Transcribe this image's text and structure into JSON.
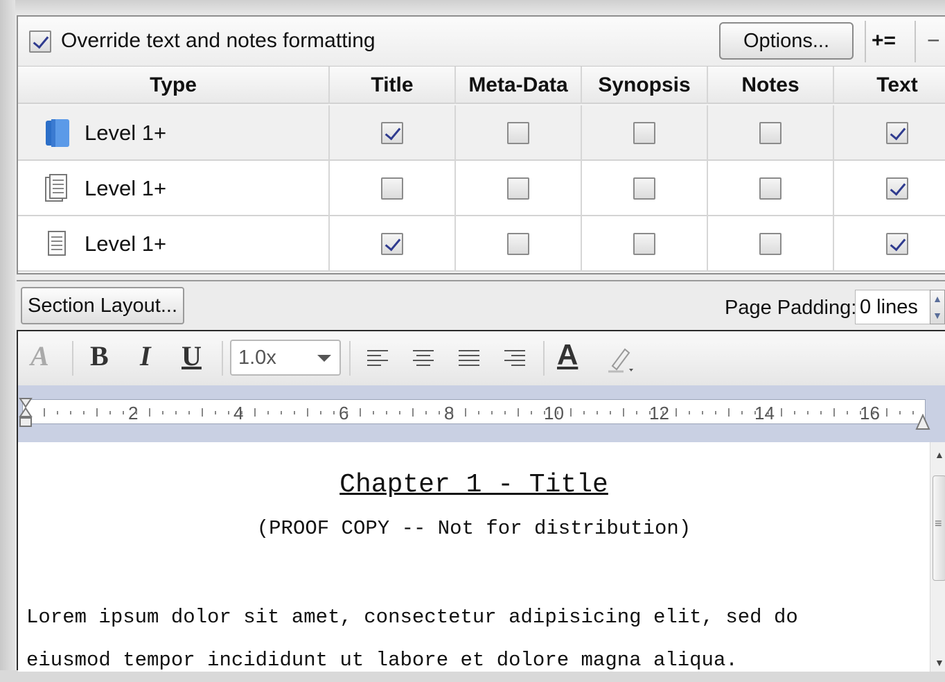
{
  "override": {
    "checked": true,
    "label": "Override text and notes formatting",
    "options_label": "Options...",
    "add_label": "+=",
    "remove_label": "−"
  },
  "columns": [
    "Type",
    "Title",
    "Meta-Data",
    "Synopsis",
    "Notes",
    "Text"
  ],
  "rows": [
    {
      "icon": "folder-icon",
      "label": "Level 1+",
      "title": true,
      "metadata": false,
      "synopsis": false,
      "notes": false,
      "text": true
    },
    {
      "icon": "document-stack-icon",
      "label": "Level 1+",
      "title": false,
      "metadata": false,
      "synopsis": false,
      "notes": false,
      "text": true
    },
    {
      "icon": "document-icon",
      "label": "Level 1+",
      "title": true,
      "metadata": false,
      "synopsis": false,
      "notes": false,
      "text": true
    }
  ],
  "section": {
    "layout_button": "Section Layout...",
    "padding_label": "Page Padding:",
    "padding_value": "0 lines"
  },
  "toolbar": {
    "style_icon": "A",
    "bold": "B",
    "italic": "I",
    "underline": "U",
    "zoom": "1.0x",
    "text_color_icon": "A"
  },
  "ruler": {
    "labels": [
      "2",
      "4",
      "6",
      "8",
      "10",
      "12",
      "14",
      "16"
    ]
  },
  "document": {
    "title": "Chapter 1 - Title",
    "subtitle": "(PROOF COPY -- Not for distribution)",
    "line1": "Lorem ipsum dolor sit amet, consectetur adipisicing elit, sed do",
    "line2": "eiusmod tempor incididunt ut labore et dolore magna aliqua."
  },
  "colors": {
    "check_mark": "#2f3b8f",
    "ruler_band": "#c9d0e3",
    "folder_blue": "#3a7ad1"
  }
}
